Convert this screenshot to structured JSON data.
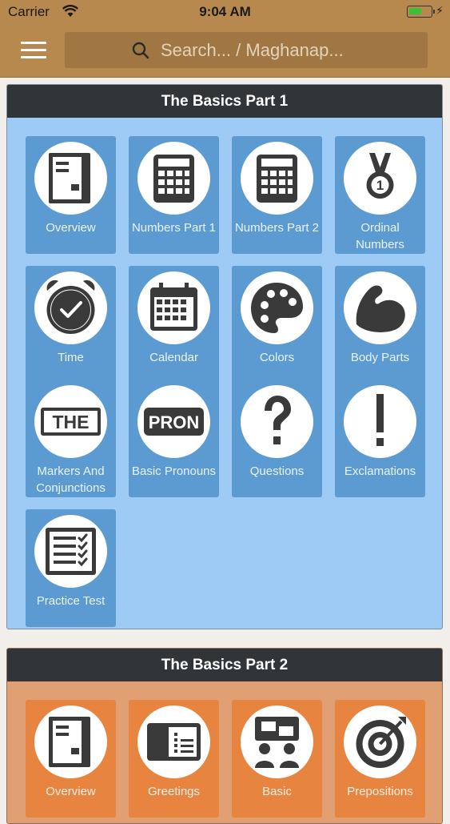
{
  "status_bar": {
    "carrier": "Carrier",
    "time": "9:04 AM"
  },
  "nav": {
    "search_placeholder": "Search... / Maghanap..."
  },
  "sections": [
    {
      "title": "The Basics Part 1",
      "tiles": [
        {
          "label": "Overview",
          "icon": "book-icon"
        },
        {
          "label": "Numbers Part 1",
          "icon": "calculator-icon"
        },
        {
          "label": "Numbers Part 2",
          "icon": "calculator-icon"
        },
        {
          "label": "Ordinal Numbers",
          "icon": "medal-icon"
        },
        {
          "label": "Time",
          "icon": "alarm-clock-icon"
        },
        {
          "label": "Calendar",
          "icon": "calendar-icon"
        },
        {
          "label": "Colors",
          "icon": "palette-icon"
        },
        {
          "label": "Body Parts",
          "icon": "flexed-arm-icon"
        },
        {
          "label": "Markers And Conjunctions",
          "icon": "the-sign-icon"
        },
        {
          "label": "Basic Pronouns",
          "icon": "pron-sign-icon"
        },
        {
          "label": "Questions",
          "icon": "question-mark-icon"
        },
        {
          "label": "Exclamations",
          "icon": "exclamation-mark-icon"
        },
        {
          "label": "Practice Test",
          "icon": "checklist-icon"
        }
      ]
    },
    {
      "title": "The Basics Part 2",
      "tiles": [
        {
          "label": "Overview",
          "icon": "book-icon"
        },
        {
          "label": "Greetings",
          "icon": "postcard-icon"
        },
        {
          "label": "Basic",
          "icon": "chat-people-icon"
        },
        {
          "label": "Prepositions",
          "icon": "target-icon"
        }
      ]
    }
  ],
  "colors": {
    "nav_bar": "#b8894f",
    "section1_bg": "#9ecbf5",
    "section1_tile": "#5c9ad2",
    "section2_bg": "#e0a074",
    "section2_tile": "#e78540",
    "header_bg": "#323537",
    "icon_dark": "#3a3a3a"
  }
}
